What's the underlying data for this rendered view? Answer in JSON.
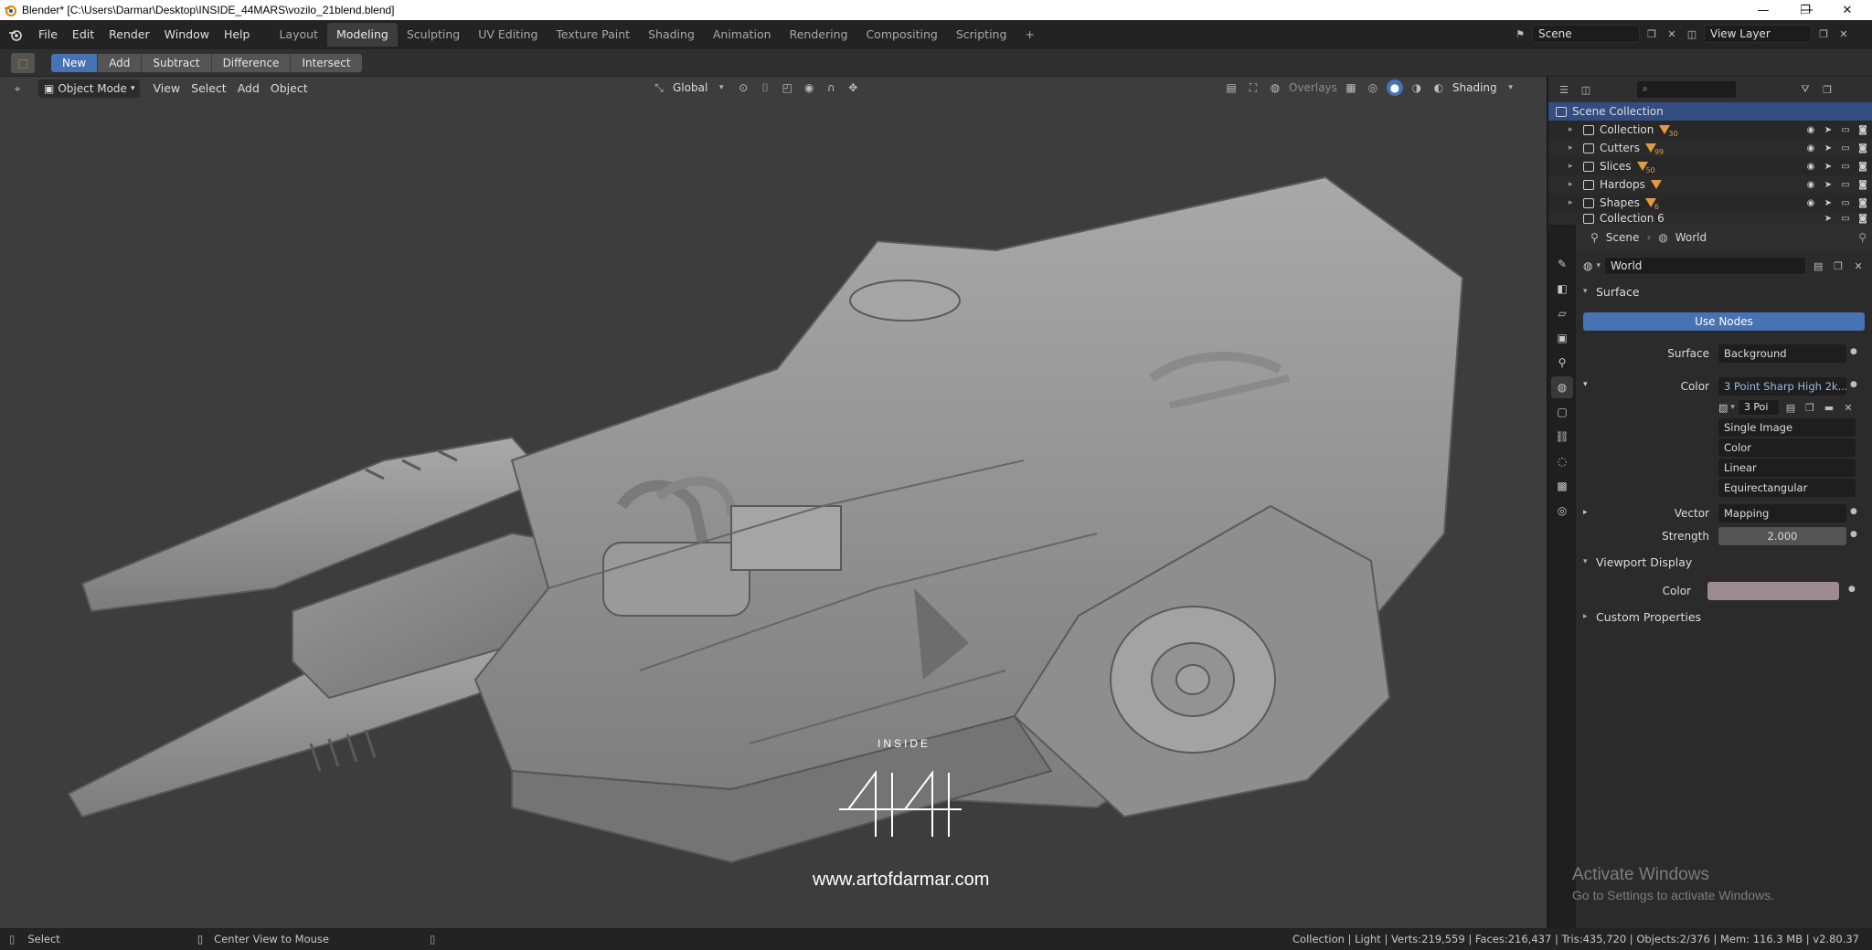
{
  "window": {
    "title": "Blender* [C:\\Users\\Darmar\\Desktop\\INSIDE_44MARS\\vozilo_21blend.blend]",
    "controls": [
      "—",
      "❐",
      "✕"
    ]
  },
  "menubar": {
    "menus": [
      "File",
      "Edit",
      "Render",
      "Window",
      "Help"
    ],
    "workspaces": [
      "Layout",
      "Modeling",
      "Sculpting",
      "UV Editing",
      "Texture Paint",
      "Shading",
      "Animation",
      "Rendering",
      "Compositing",
      "Scripting"
    ],
    "active_workspace": "Modeling",
    "add_workspace": "+",
    "scene_label": "Scene",
    "view_layer_label": "View Layer"
  },
  "tool_header": {
    "boolean_ops": [
      "New",
      "Add",
      "Subtract",
      "Difference",
      "Intersect"
    ],
    "active_op": "New"
  },
  "viewport": {
    "mode": "Object Mode",
    "menus": [
      "View",
      "Select",
      "Add",
      "Object"
    ],
    "orientation": "Global",
    "overlays_label": "Overlays",
    "shading_label": "Shading",
    "logo_title": "INSIDE",
    "logo_url": "www.artofdarmar.com"
  },
  "outliner": {
    "root": "Scene Collection",
    "rows": [
      {
        "name": "Collection",
        "badge": "30"
      },
      {
        "name": "Cutters",
        "badge": "99"
      },
      {
        "name": "Slices",
        "badge": "50"
      },
      {
        "name": "Hardops",
        "badge": ""
      },
      {
        "name": "Shapes",
        "badge": "6"
      },
      {
        "name": "Collection 6",
        "badge": ""
      }
    ]
  },
  "properties": {
    "context": {
      "scene": "Scene",
      "world": "World"
    },
    "world_name": "World",
    "surface_panel": "Surface",
    "use_nodes": "Use Nodes",
    "surface_label": "Surface",
    "surface_value": "Background",
    "color_label": "Color",
    "color_value": "3 Point Sharp High 2k...",
    "image_name": "3 Poi",
    "image_source": "Single Image",
    "color_space": "Color",
    "interpolation": "Linear",
    "projection": "Equirectangular",
    "vector_label": "Vector",
    "vector_value": "Mapping",
    "strength_label": "Strength",
    "strength_value": "2.000",
    "viewport_display_panel": "Viewport Display",
    "vd_color_label": "Color",
    "vd_color": "#9c8b8f",
    "custom_props_panel": "Custom Properties"
  },
  "statusbar": {
    "left_action": "Select",
    "mid_action": "Center View to Mouse",
    "stats": "Collection | Light | Verts:219,559 | Faces:216,437 | Tris:435,720 | Objects:2/376 | Mem: 116.3 MB | v2.80.37"
  },
  "watermark": {
    "line1": "Activate Windows",
    "line2": "Go to Settings to activate Windows."
  }
}
